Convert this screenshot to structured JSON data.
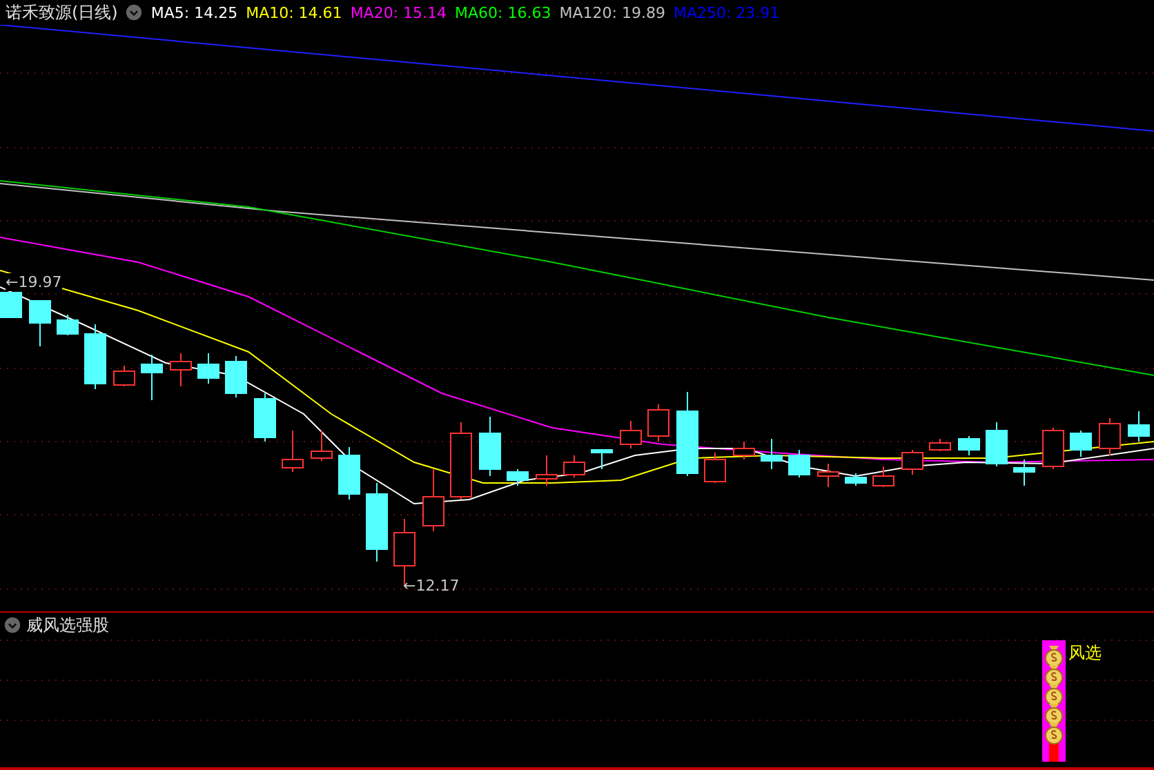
{
  "header": {
    "title": "诺禾致源(日线)",
    "legend": [
      {
        "label": "MA5: 14.25",
        "color": "#ffffff"
      },
      {
        "label": "MA10: 14.61",
        "color": "#ffff00"
      },
      {
        "label": "MA20: 15.14",
        "color": "#ff00ff"
      },
      {
        "label": "MA60: 16.63",
        "color": "#00ff00"
      },
      {
        "label": "MA120: 19.89",
        "color": "#c0c0c0"
      },
      {
        "label": "MA250: 23.91",
        "color": "#0000ff"
      }
    ]
  },
  "main_chart": {
    "high_label": "←19.97",
    "low_label": "←12.17"
  },
  "indicator": {
    "title": "威风选强股",
    "signal_label": "风选"
  }
}
